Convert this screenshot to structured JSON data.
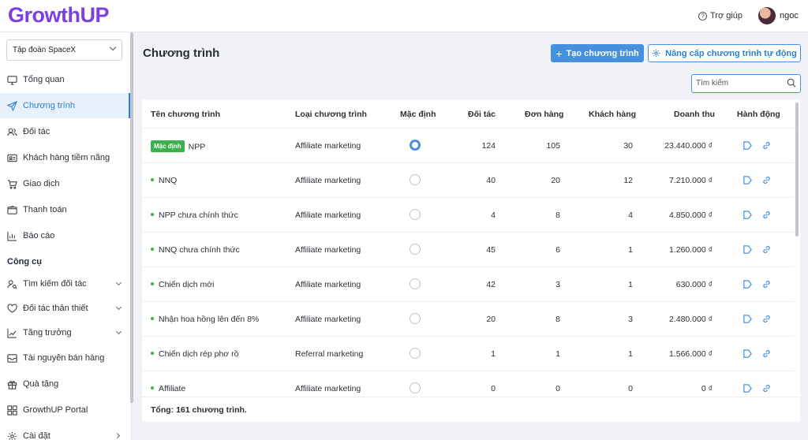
{
  "brand": {
    "logo": "GrowthUP"
  },
  "header": {
    "help_label": "Trợ giúp",
    "user_name": "ngoc"
  },
  "sidebar": {
    "org_select": "Tập đoàn SpaceX",
    "items": [
      {
        "label": "Tổng quan",
        "icon": "monitor-icon"
      },
      {
        "label": "Chương trình",
        "icon": "send-icon",
        "active": true
      },
      {
        "label": "Đối tác",
        "icon": "users-icon"
      },
      {
        "label": "Khách hàng tiềm năng",
        "icon": "id-card-icon"
      },
      {
        "label": "Giao dịch",
        "icon": "cart-icon"
      },
      {
        "label": "Thanh toán",
        "icon": "wallet-icon"
      },
      {
        "label": "Báo cáo",
        "icon": "bar-chart-icon"
      }
    ],
    "section_label": "Công cụ",
    "tools": [
      {
        "label": "Tìm kiếm đối tác",
        "icon": "user-search-icon",
        "expandable": true
      },
      {
        "label": "Đối tác thân thiết",
        "icon": "heart-icon",
        "expandable": true
      },
      {
        "label": "Tăng trưởng",
        "icon": "trend-icon",
        "expandable": true
      },
      {
        "label": "Tài nguyên bán hàng",
        "icon": "inbox-icon"
      },
      {
        "label": "Quà tặng",
        "icon": "gift-icon"
      },
      {
        "label": "GrowthUP Portal",
        "icon": "grid-icon"
      },
      {
        "label": "Cài đặt",
        "icon": "gear-icon",
        "has_submenu": true
      }
    ]
  },
  "main": {
    "title": "Chương trình",
    "create_button": "Tạo chương trình",
    "upgrade_button": "Nâng cấp chương trình tự động",
    "search_placeholder": "Tìm kiếm",
    "table": {
      "columns": [
        "Tên chương trình",
        "Loại chương trình",
        "Mặc định",
        "Đối tác",
        "Đơn hàng",
        "Khách hàng",
        "Doanh thu",
        "Hành động"
      ],
      "default_badge": "Mặc định",
      "rows": [
        {
          "name": "NPP",
          "type": "Affiliate marketing",
          "default": true,
          "partners": "124",
          "orders": "105",
          "customers": "30",
          "revenue": "23.440.000 ₫"
        },
        {
          "name": "NNQ",
          "type": "Affiliate marketing",
          "default": false,
          "partners": "40",
          "orders": "20",
          "customers": "12",
          "revenue": "7.210.000 ₫"
        },
        {
          "name": "NPP chưa chính thức",
          "type": "Affiliate marketing",
          "default": false,
          "partners": "4",
          "orders": "8",
          "customers": "4",
          "revenue": "4.850.000 ₫"
        },
        {
          "name": "NNQ chưa chính thức",
          "type": "Affiliate marketing",
          "default": false,
          "partners": "45",
          "orders": "6",
          "customers": "1",
          "revenue": "1.260.000 ₫"
        },
        {
          "name": "Chiến dịch mới",
          "type": "Affiliate marketing",
          "default": false,
          "partners": "42",
          "orders": "3",
          "customers": "1",
          "revenue": "630.000 ₫"
        },
        {
          "name": "Nhận hoa hồng lên đến 8%",
          "type": "Affiliate marketing",
          "default": false,
          "partners": "20",
          "orders": "8",
          "customers": "3",
          "revenue": "2.480.000 ₫"
        },
        {
          "name": "Chiến dịch rép phơ rồ",
          "type": "Referral marketing",
          "default": false,
          "partners": "1",
          "orders": "1",
          "customers": "1",
          "revenue": "1.566.000 ₫"
        },
        {
          "name": "Affiliate",
          "type": "Affiliate marketing",
          "default": false,
          "partners": "0",
          "orders": "0",
          "customers": "0",
          "revenue": "0 ₫"
        }
      ],
      "footer": "Tổng: 161 chương trình."
    }
  },
  "colors": {
    "brand": "#7b3fe4",
    "primary": "#4591e0",
    "status_green": "#3ab14a"
  }
}
